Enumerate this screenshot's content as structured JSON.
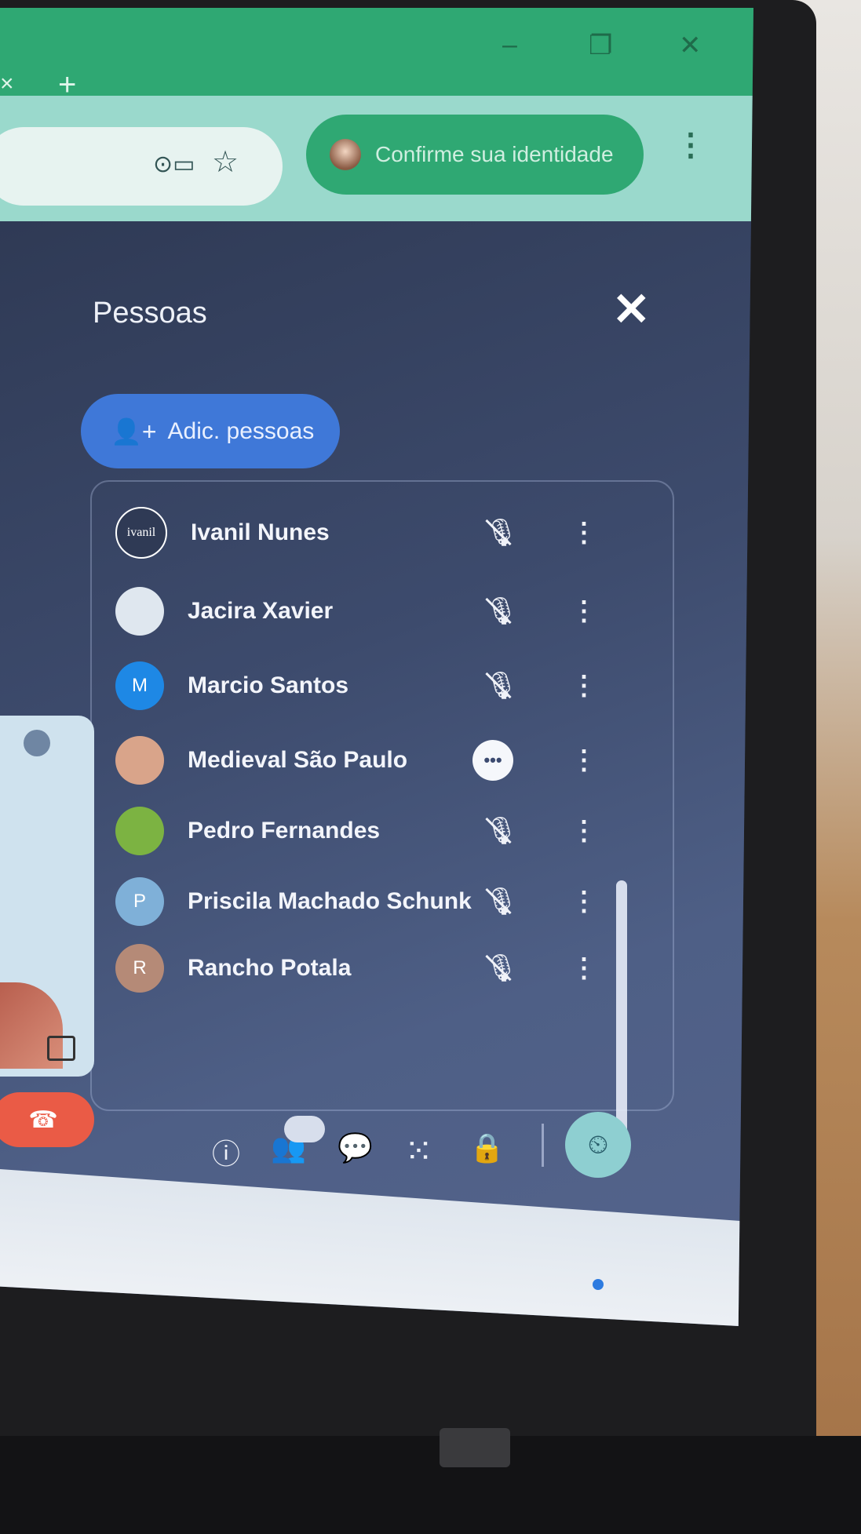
{
  "browser": {
    "tab_close_glyph": "×",
    "new_tab_glyph": "+",
    "window_controls": [
      "–",
      "❐",
      "✕"
    ],
    "key_icon": "key-icon",
    "star_icon": "star-icon",
    "identity_chip": "Confirme sua identidade",
    "menu_glyph": "⋮"
  },
  "panel": {
    "title": "Pessoas",
    "close_glyph": "✕",
    "add_people_label": "Adic. pessoas",
    "add_people_icon": "👤+"
  },
  "participants": [
    {
      "name": "Ivanil Nunes",
      "avatar_text": "ivanil",
      "avatar_color": "#2f3a55",
      "status": "muted"
    },
    {
      "name": "Jacira Xavier",
      "avatar_text": "",
      "avatar_color": "#dfe7ef",
      "status": "muted"
    },
    {
      "name": "Marcio Santos",
      "avatar_text": "M",
      "avatar_color": "#1e88e5",
      "status": "muted"
    },
    {
      "name": "Medieval São Paulo",
      "avatar_text": "",
      "avatar_color": "#d9a48a",
      "status": "more"
    },
    {
      "name": "Pedro Fernandes",
      "avatar_text": "",
      "avatar_color": "#7cb342",
      "status": "muted"
    },
    {
      "name": "Priscila Machado Schunk",
      "avatar_text": "P",
      "avatar_color": "#7fb0d8",
      "status": "muted"
    },
    {
      "name": "Rancho Potala",
      "avatar_text": "R",
      "avatar_color": "#b58a77",
      "status": "muted"
    }
  ],
  "mic_off_glyph": "🎙",
  "more_glyph": "•••",
  "row_menu_glyph": "⋮",
  "controls": {
    "info_glyph": "ⓘ",
    "people_glyph": "👥",
    "people_badge": "",
    "chat_glyph": "💬",
    "apps_glyph": "⁙",
    "host_glyph": "🔒",
    "activity_glyph": "⏲",
    "end_call_glyph": "☎"
  }
}
